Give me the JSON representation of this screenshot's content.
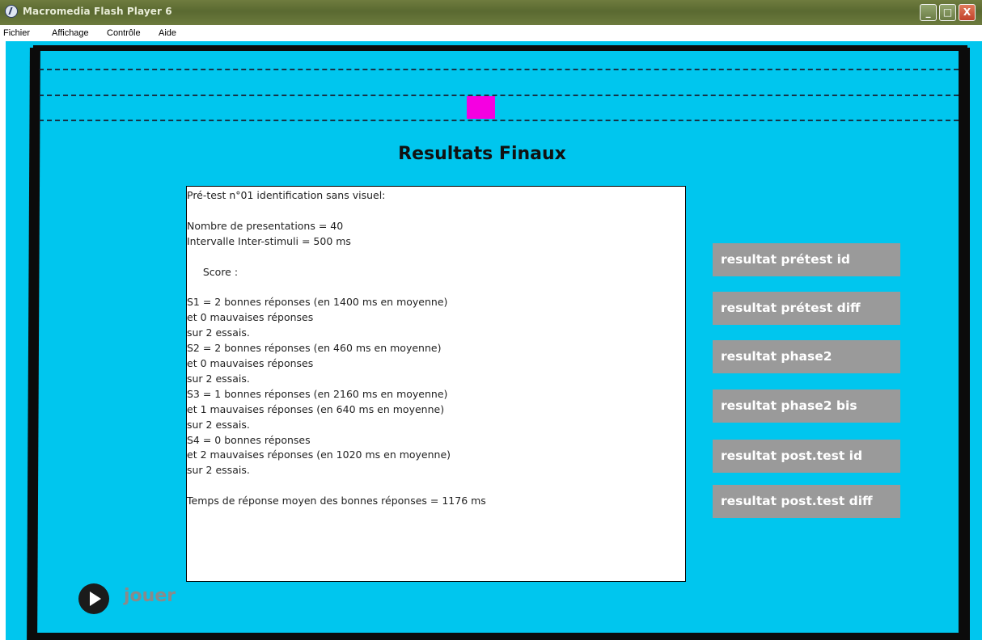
{
  "window": {
    "title": "Macromedia Flash Player 6",
    "controls": {
      "minimize": "_",
      "maximize": "□",
      "close": "X"
    }
  },
  "menu": {
    "items": [
      "Fichier",
      "Affichage",
      "Contrôle",
      "Aide"
    ]
  },
  "colors": {
    "stage_background": "#00c6ee",
    "marker": "#f500e1",
    "side_button": "#9a9a9a"
  },
  "page": {
    "title": "Resultats Finaux"
  },
  "results": {
    "lines": [
      "Pré-test n°01 identification sans visuel:",
      "",
      "Nombre de presentations = 40",
      "Intervalle Inter-stimuli = 500 ms",
      "",
      "     Score :",
      "",
      "S1 = 2 bonnes réponses (en 1400 ms en moyenne)",
      "et 0 mauvaises réponses",
      "sur 2 essais.",
      "S2 = 2 bonnes réponses (en 460 ms en moyenne)",
      "et 0 mauvaises réponses",
      "sur 2 essais.",
      "S3 = 1 bonnes réponses (en 2160 ms en moyenne)",
      "et 1 mauvaises réponses (en 640 ms en moyenne)",
      "sur 2 essais.",
      "S4 = 0 bonnes réponses",
      "et 2 mauvaises réponses (en 1020 ms en moyenne)",
      "sur 2 essais.",
      "",
      "Temps de réponse moyen des bonnes réponses = 1176 ms"
    ]
  },
  "side_buttons": [
    "resultat prétest id",
    "resultat prétest diff",
    "resultat phase2",
    "resultat phase2 bis",
    "resultat post.test id",
    "resultat post.test diff"
  ],
  "play": {
    "label": "jouer"
  }
}
